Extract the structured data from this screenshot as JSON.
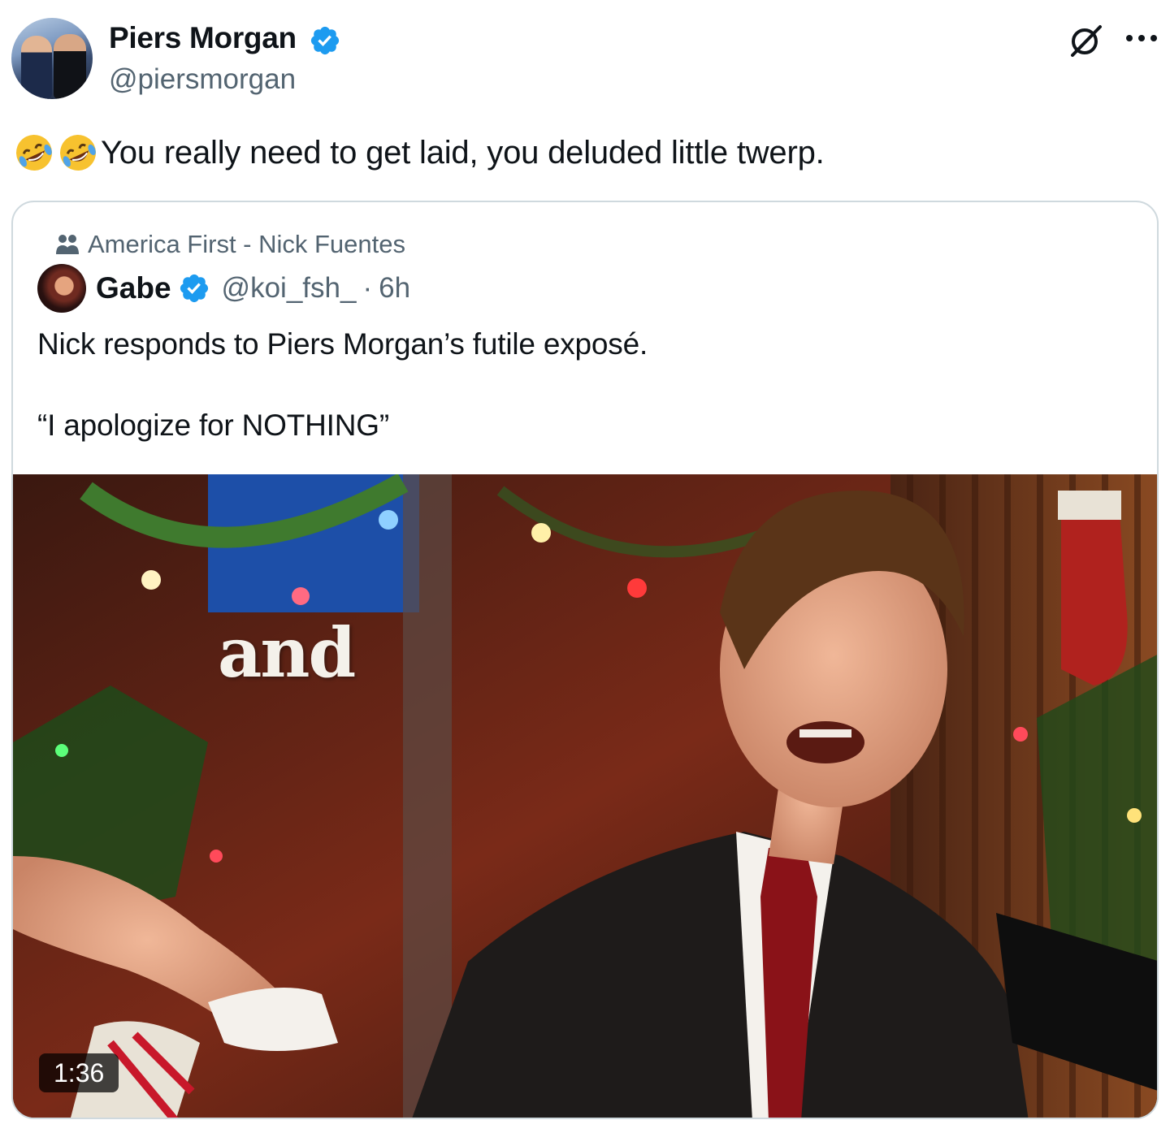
{
  "author": {
    "display_name": "Piers Morgan",
    "handle": "@piersmorgan",
    "verified": true,
    "avatar_icon": "avatar-piers-morgan"
  },
  "actions": {
    "grok_icon": "grok-icon",
    "more_icon": "more-horizontal-icon"
  },
  "tweet": {
    "emojis": [
      "🤣",
      "🤣"
    ],
    "text": "You really need to get laid, you deluded little twerp."
  },
  "quoted_tweet": {
    "community": "America First - Nick Fuentes",
    "community_icon": "community-icon",
    "author": {
      "display_name": "Gabe",
      "handle": "@koi_fsh_",
      "verified": true
    },
    "separator": "·",
    "time": "6h",
    "text_lines": [
      "Nick responds to Piers Morgan’s futile exposé.",
      "“I apologize for NOTHING”"
    ],
    "media": {
      "type": "video",
      "caption_overlay": "and",
      "duration": "1:36"
    }
  },
  "colors": {
    "text_primary": "#0f1419",
    "text_secondary": "#536471",
    "verified_blue": "#1d9bf0",
    "border": "#cfd9de"
  }
}
